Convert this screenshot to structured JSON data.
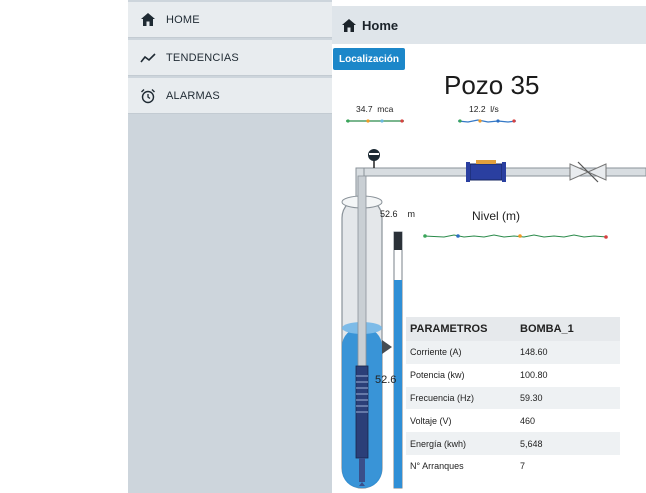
{
  "sidebar": {
    "items": [
      {
        "label": "HOME",
        "icon": "home-icon"
      },
      {
        "label": "TENDENCIAS",
        "icon": "trend-icon"
      },
      {
        "label": "ALARMAS",
        "icon": "alarm-clock-icon"
      }
    ]
  },
  "header": {
    "title": "Home",
    "icon": "home-icon"
  },
  "tab": {
    "label": "Localización",
    "color": "#1c87c9"
  },
  "page": {
    "title": "Pozo 35"
  },
  "gauges": {
    "pressure": {
      "value": "34.7",
      "unit": "mca"
    },
    "flow": {
      "value": "12.2",
      "unit": "l/s"
    }
  },
  "level": {
    "value": "52.6",
    "unit": "m",
    "chart_label": "Nivel (m)",
    "side_value": "52.6"
  },
  "parameters": {
    "header": [
      "PARAMETROS",
      "BOMBA_1"
    ],
    "rows": [
      {
        "name": "Corriente (A)",
        "value": "148.60"
      },
      {
        "name": "Potencia (kw)",
        "value": "100.80"
      },
      {
        "name": "Frecuencia (Hz)",
        "value": "59.30"
      },
      {
        "name": "Voltaje (V)",
        "value": "460"
      },
      {
        "name": "Energía (kwh)",
        "value": "5,648"
      },
      {
        "name": "N° Arranques",
        "value": "7"
      }
    ]
  },
  "colors": {
    "water": "#2f8fd6",
    "accent": "#1c87c9",
    "sidebar": "#cdd5dc"
  }
}
